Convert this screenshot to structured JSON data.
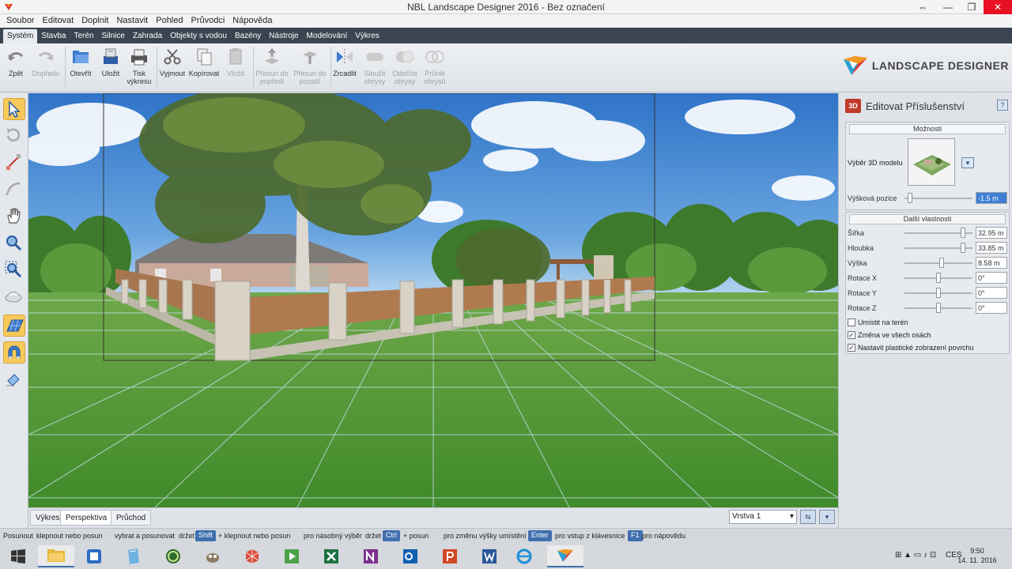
{
  "window": {
    "title": "NBL Landscape Designer 2016 - Bez označení",
    "restore_glyph": "⇔",
    "min_glyph": "—",
    "max_glyph": "❐",
    "close_glyph": "✕"
  },
  "menu": [
    "Soubor",
    "Editovat",
    "Doplnit",
    "Nastavit",
    "Pohled",
    "Průvodci",
    "Nápověda"
  ],
  "tabs": [
    "Systém",
    "Stavba",
    "Terén",
    "Silnice",
    "Zahrada",
    "Objekty s vodou",
    "Bazény",
    "Nástroje",
    "Modelování",
    "Výkres"
  ],
  "toolbar": {
    "undo": "Zpět",
    "redo": "Dopředu",
    "open": "Otevřít",
    "save": "Uložit",
    "print_l1": "Tisk",
    "print_l2": "výkresu",
    "cut": "Vyjmout",
    "copy": "Kopírovat",
    "paste": "Vložit",
    "front_l1": "Přesun do",
    "front_l2": "popředí",
    "back_l1": "Přesun do",
    "back_l2": "pozadí",
    "mirror": "Zrcadlit",
    "merge_l1": "Sloučit",
    "merge_l2": "obrysy",
    "subtract_l1": "Odečíst",
    "subtract_l2": "obrysy",
    "intersect_l1": "Průnik",
    "intersect_l2": "obrysů"
  },
  "logo": {
    "text": "LANDSCAPE DESIGNER"
  },
  "view_tabs": {
    "drawing": "Výkres",
    "perspective": "Perspektiva",
    "walk": "Průchod"
  },
  "layer": {
    "value": "Vrstva 1",
    "arrow": "▾",
    "btn1": "⇆",
    "btn2": "▾"
  },
  "panel": {
    "badge": "3D",
    "title": "Editovat Příslušenství",
    "help": "?",
    "options_group": "Možnosti",
    "model_label": "Výběr 3D modelu",
    "model_btn": "▾",
    "height_label": "Výšková pozice",
    "height_value": "-1.5 m",
    "props_group": "Další vlastnosti",
    "props": [
      {
        "label": "Šířka",
        "value": "32.95 m",
        "pos": 0.86
      },
      {
        "label": "Hloubka",
        "value": "33.85 m",
        "pos": 0.86
      },
      {
        "label": "Výška",
        "value": "8.58 m",
        "pos": 0.55
      },
      {
        "label": "Rotace X",
        "value": "0°",
        "pos": 0.5
      },
      {
        "label": "Rotace Y",
        "value": "0°",
        "pos": 0.5
      },
      {
        "label": "Rotace Z",
        "value": "0°",
        "pos": 0.5
      }
    ],
    "height_pos": 0.05,
    "checkboxes": [
      {
        "label": "Umístit na terén",
        "checked": false
      },
      {
        "label": "Změna ve všech osách",
        "checked": true
      },
      {
        "label": "Nastavit plastické zobrazení povrchu",
        "checked": true
      }
    ],
    "check_mark": "✓"
  },
  "status": {
    "s1": "Posunout",
    "s2": "klepnout nebo posun",
    "s3": "vybrat a posunovat",
    "s4": "držet",
    "k1": "Shift",
    "s5": "+ klepnout nebo posun",
    "s6": "pro násobný výběr",
    "s7": "držet",
    "k2": "Ctrl",
    "s8": "+ posun",
    "s9": "pro změnu výšky umístění",
    "k3": "Enter",
    "s10": "pro vstup z klávesnice",
    "k4": "F1",
    "s11": "pro nápovědu"
  },
  "taskbar": {
    "lang": "CES",
    "time": "9:50",
    "date": "14. 11. 2016",
    "tray_icons": "⊞ ▲ ▭ ♪ ⊡"
  }
}
